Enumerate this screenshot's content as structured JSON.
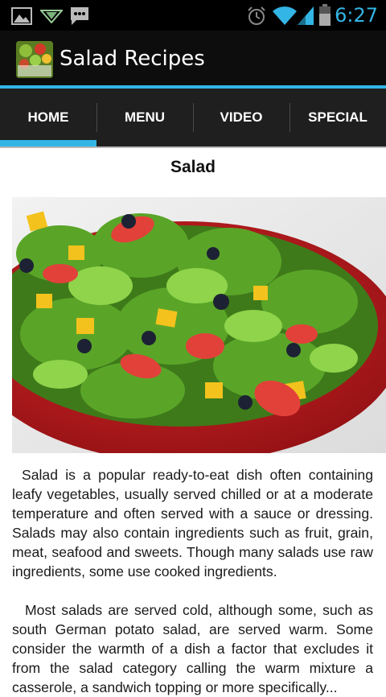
{
  "status_bar": {
    "time": "6:27",
    "left_icons": [
      "image-icon",
      "download-arrow-icon",
      "chat-bubble-icon"
    ],
    "right_icons": [
      "alarm-clock-icon",
      "wifi-icon",
      "signal-icon",
      "battery-icon"
    ],
    "accent_color": "#33b5e5"
  },
  "action_bar": {
    "title": "Salad Recipes",
    "icon": "salad-recipes-app-icon",
    "icon_text": "SALAD RECIPES"
  },
  "tabs": [
    {
      "label": "HOME",
      "active": true
    },
    {
      "label": "MENU",
      "active": false
    },
    {
      "label": "VIDEO",
      "active": false
    },
    {
      "label": "SPECIAL",
      "active": false
    }
  ],
  "content": {
    "title": "Salad",
    "image": "salad-bowl-photo",
    "paragraphs": [
      "Salad is a popular ready-to-eat dish often containing leafy vegetables, usually served chilled or at a moderate temperature and often served with a sauce or dressing. Salads may also contain ingredients such as fruit, grain, meat, seafood and sweets. Though many salads use raw ingredients, some use cooked ingredients.",
      "Most salads are served cold, although some, such as south German potato salad, are served warm. Some consider the warmth of a dish a factor that excludes it from the salad category calling the warm mixture a casserole, a sandwich topping or more specifically..."
    ]
  }
}
